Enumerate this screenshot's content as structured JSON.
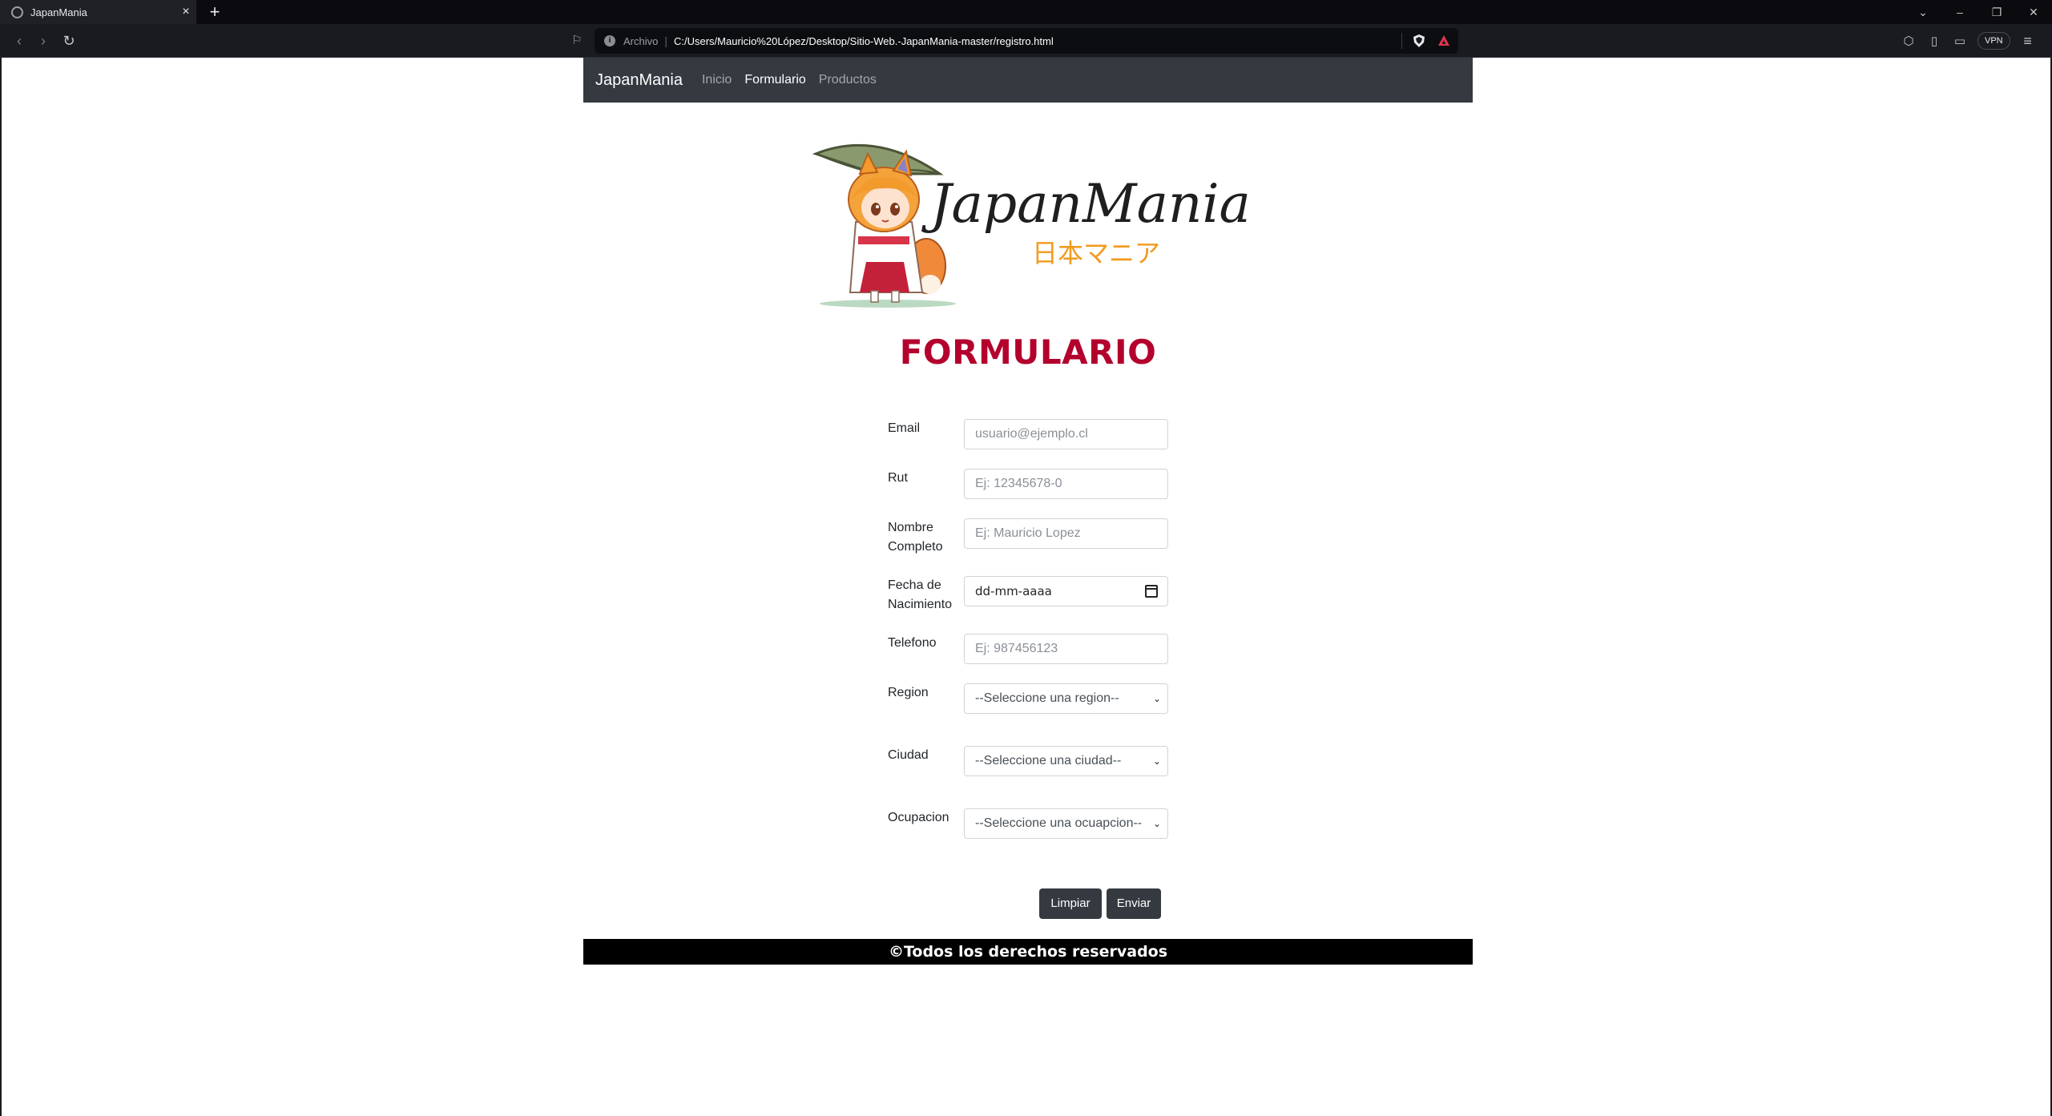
{
  "browser": {
    "tab_title": "JapanMania",
    "url_scheme": "Archivo",
    "url": "C:/Users/Mauricio%20López/Desktop/Sitio-Web.-JapanMania-master/registro.html",
    "vpn_label": "VPN"
  },
  "nav": {
    "brand": "JapanMania",
    "links": [
      "Inicio",
      "Formulario",
      "Productos"
    ],
    "active": "Formulario"
  },
  "logo": {
    "text": "JapanMania",
    "subtitle": "日本マニア"
  },
  "form": {
    "title": "FORMULARIO",
    "email": {
      "label": "Email",
      "placeholder": "usuario@ejemplo.cl"
    },
    "rut": {
      "label": "Rut",
      "placeholder": "Ej: 12345678-0"
    },
    "nombre": {
      "label": "Nombre Completo",
      "placeholder": "Ej: Mauricio Lopez"
    },
    "fecha": {
      "label": "Fecha de Nacimiento",
      "value": "dd-mm-aaaa"
    },
    "telefono": {
      "label": "Telefono",
      "placeholder": "Ej: 987456123"
    },
    "region": {
      "label": "Region",
      "selected": "--Seleccione una region--"
    },
    "ciudad": {
      "label": "Ciudad",
      "selected": "--Seleccione una ciudad--"
    },
    "ocupacion": {
      "label": "Ocupacion",
      "selected": "--Seleccione una ocuapcion--"
    },
    "clear_label": "Limpiar",
    "submit_label": "Enviar"
  },
  "footer": {
    "text": "©Todos los derechos reservados"
  },
  "colors": {
    "navbar": "#343a40",
    "title": "#b3002d",
    "logo_orange": "#f29a1d",
    "footer": "#000000"
  }
}
